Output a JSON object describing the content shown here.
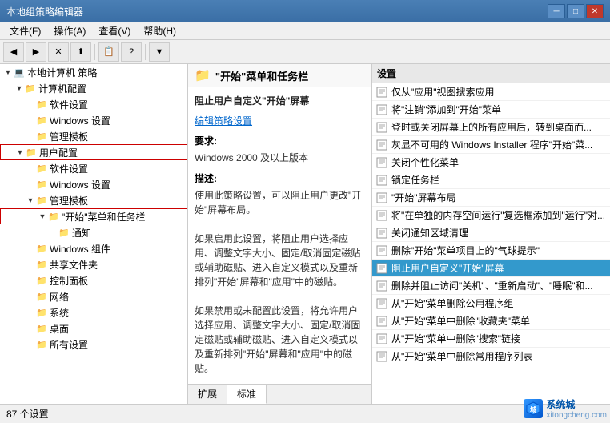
{
  "titleBar": {
    "title": "本地组策略编辑器",
    "minBtn": "─",
    "maxBtn": "□",
    "closeBtn": "✕"
  },
  "menuBar": {
    "items": [
      {
        "label": "文件(F)"
      },
      {
        "label": "操作(A)"
      },
      {
        "label": "查看(V)"
      },
      {
        "label": "帮助(H)"
      }
    ]
  },
  "toolbar": {
    "buttons": [
      "◀",
      "▶",
      "✕",
      "⬆",
      "📋",
      "?",
      "▼"
    ]
  },
  "tree": {
    "items": [
      {
        "id": "local",
        "label": "本地计算机 策略",
        "indent": 0,
        "arrow": "▼",
        "icon": "💻",
        "expanded": true
      },
      {
        "id": "computer",
        "label": "计算机配置",
        "indent": 1,
        "arrow": "▼",
        "icon": "📁",
        "expanded": true
      },
      {
        "id": "software",
        "label": "软件设置",
        "indent": 2,
        "arrow": " ",
        "icon": "📁"
      },
      {
        "id": "windows",
        "label": "Windows 设置",
        "indent": 2,
        "arrow": " ",
        "icon": "📁"
      },
      {
        "id": "admin1",
        "label": "管理模板",
        "indent": 2,
        "arrow": " ",
        "icon": "📁"
      },
      {
        "id": "user",
        "label": "用户配置",
        "indent": 1,
        "arrow": "▼",
        "icon": "📁",
        "expanded": true,
        "highlighted": true
      },
      {
        "id": "software2",
        "label": "软件设置",
        "indent": 2,
        "arrow": " ",
        "icon": "📁"
      },
      {
        "id": "windows2",
        "label": "Windows 设置",
        "indent": 2,
        "arrow": " ",
        "icon": "📁"
      },
      {
        "id": "admin2",
        "label": "管理模板",
        "indent": 2,
        "arrow": "▼",
        "icon": "📁",
        "expanded": true
      },
      {
        "id": "startmenu",
        "label": "\"开始\"菜单和任务栏",
        "indent": 3,
        "arrow": "▼",
        "icon": "📁",
        "expanded": true,
        "highlighted": true
      },
      {
        "id": "notice",
        "label": "通知",
        "indent": 4,
        "arrow": " ",
        "icon": "📁"
      },
      {
        "id": "windows_comp",
        "label": "Windows 组件",
        "indent": 2,
        "arrow": " ",
        "icon": "📁"
      },
      {
        "id": "shared",
        "label": "共享文件夹",
        "indent": 2,
        "arrow": " ",
        "icon": "📁"
      },
      {
        "id": "control",
        "label": "控制面板",
        "indent": 2,
        "arrow": " ",
        "icon": "📁"
      },
      {
        "id": "network",
        "label": "网络",
        "indent": 2,
        "arrow": " ",
        "icon": "📁"
      },
      {
        "id": "system",
        "label": "系统",
        "indent": 2,
        "arrow": " ",
        "icon": "📁"
      },
      {
        "id": "desktop",
        "label": "桌面",
        "indent": 2,
        "arrow": " ",
        "icon": "📁"
      },
      {
        "id": "allsettings",
        "label": "所有设置",
        "indent": 2,
        "arrow": " ",
        "icon": "📁"
      }
    ]
  },
  "folderHeader": {
    "icon": "📁",
    "title": "\"开始\"菜单和任务栏"
  },
  "detail": {
    "title": "阻止用户自定义\"开始\"屏幕",
    "editLink": "编辑策略设置",
    "requireLabel": "要求:",
    "requireText": "Windows 2000 及以上版本",
    "descLabel": "描述:",
    "descText": "使用此策略设置，可以阻止用户更改\"开始\"屏幕布局。\n\n如果启用此设置，将阻止用户选择应用、调整文字大小、固定/取消固定磁贴或辅助磁贴、进入自定义模式以及重新排列\"开始\"屏幕和\"应用\"中的磁贴。\n\n如果禁用或未配置此设置，将允许用户选择应用、调整文字大小、固定/取消固定磁贴或辅助磁贴、进入自定义模式以及重新排列\"开始\"屏幕和\"应用\"中的磁贴。",
    "tabs": [
      {
        "label": "扩展",
        "active": false
      },
      {
        "label": "标准",
        "active": false
      }
    ]
  },
  "settings": {
    "header": "设置",
    "items": [
      {
        "label": "仅从\"应用\"视图搜索应用",
        "selected": false
      },
      {
        "label": "将\"注销\"添加到\"开始\"菜单",
        "selected": false
      },
      {
        "label": "登时或关闭屏幕上的所有应用后，转到桌面而...",
        "selected": false
      },
      {
        "label": "灰显不可用的 Windows Installer 程序\"开始\"菜...",
        "selected": false
      },
      {
        "label": "关闭个性化菜单",
        "selected": false
      },
      {
        "label": "锁定任务栏",
        "selected": false
      },
      {
        "label": "\"开始\"屏幕布局",
        "selected": false
      },
      {
        "label": "将\"在单独的内存空间运行\"复选框添加到\"运行\"对...",
        "selected": false
      },
      {
        "label": "关闭通知区域清理",
        "selected": false
      },
      {
        "label": "删除\"开始\"菜单项目上的\"气球提示\"",
        "selected": false
      },
      {
        "label": "阻止用户自定义\"开始\"屏幕",
        "selected": true
      },
      {
        "label": "删除并阻止访问\"关机\"、\"重新启动\"、\"睡眠\"和...",
        "selected": false
      },
      {
        "label": "从\"开始\"菜单删除公用程序组",
        "selected": false
      },
      {
        "label": "从\"开始\"菜单中删除\"收藏夹\"菜单",
        "selected": false
      },
      {
        "label": "从\"开始\"菜单中删除\"搜索\"链接",
        "selected": false
      },
      {
        "label": "从\"开始\"菜单中删除常用程序列表",
        "selected": false
      }
    ]
  },
  "statusBar": {
    "text": "87 个设置"
  },
  "watermark": {
    "text": "系统城",
    "subtext": "xitongcheng.com"
  }
}
